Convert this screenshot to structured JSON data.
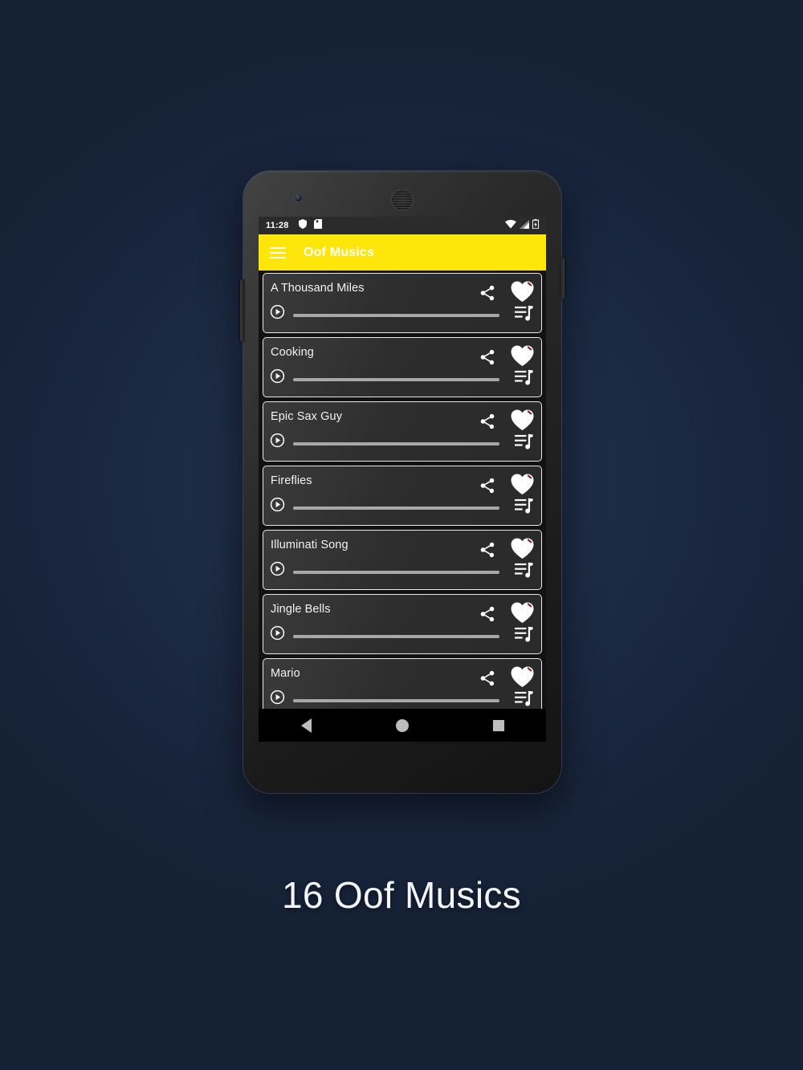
{
  "background": {
    "color_outer": "#152135",
    "color_inner": "#22324e"
  },
  "caption": {
    "text": "16 Oof Musics"
  },
  "device": {
    "name": "android-phone",
    "camera": "front-camera",
    "speaker": "earpiece-speaker",
    "buttons": {
      "volume": "volume-rocker",
      "power": "power-button"
    }
  },
  "status_bar": {
    "time": "11:28",
    "left_icons": [
      "shield-icon",
      "notification-icon"
    ],
    "right_icons": [
      "wifi-icon",
      "signal-icon",
      "battery-icon"
    ],
    "background": "#2b2b2b"
  },
  "app_bar": {
    "menu_icon": "hamburger-menu-icon",
    "title": "Oof Musics",
    "background": "#ffe60a",
    "title_color": "#ffffff"
  },
  "list": {
    "background": "#121212",
    "card_background": "#2f2f2f",
    "card_border": "#e9e9e9",
    "row_icons": {
      "share": "share-icon",
      "favorite": "heart-icon",
      "play": "play-circle-icon",
      "queue": "queue-music-icon"
    },
    "seek_progress_percent": 0,
    "items": [
      {
        "title": "A Thousand Miles",
        "favorited": false,
        "progress": 0
      },
      {
        "title": "Cooking",
        "favorited": false,
        "progress": 0
      },
      {
        "title": "Epic Sax Guy",
        "favorited": false,
        "progress": 0
      },
      {
        "title": "Fireflies",
        "favorited": false,
        "progress": 0
      },
      {
        "title": "Illuminati Song",
        "favorited": false,
        "progress": 0
      },
      {
        "title": "Jingle Bells",
        "favorited": false,
        "progress": 0
      },
      {
        "title": "Mario",
        "favorited": false,
        "progress": 0
      }
    ]
  },
  "nav_bar": {
    "back": "back-triangle-icon",
    "home": "home-circle-icon",
    "recents": "recents-square-icon",
    "background": "#000000"
  }
}
